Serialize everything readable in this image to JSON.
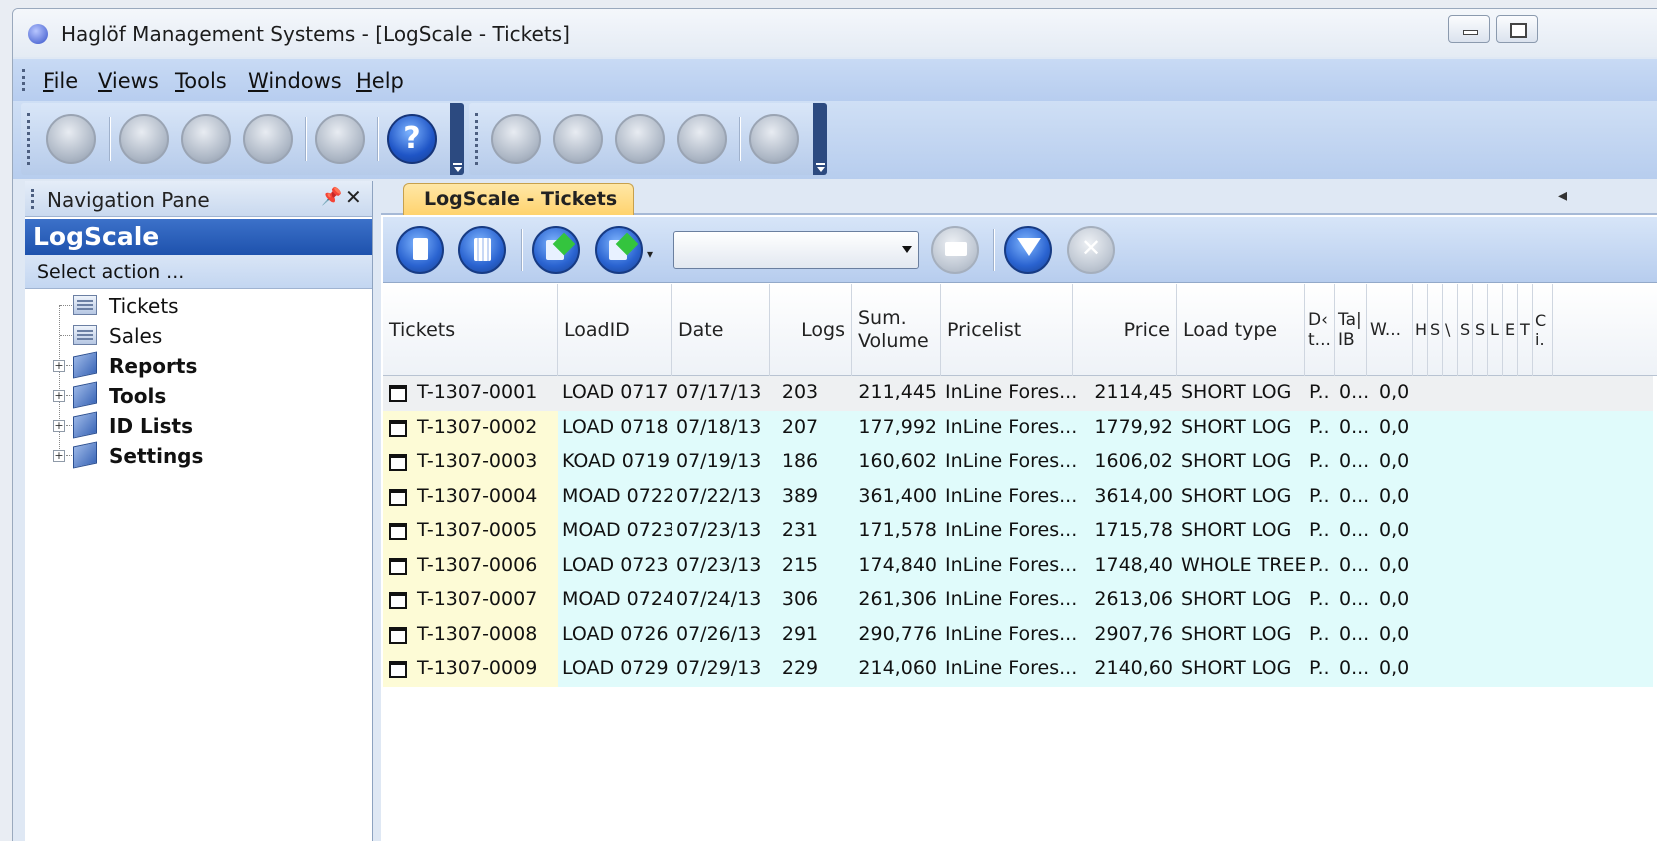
{
  "window": {
    "title": "Haglöf Management Systems - [LogScale - Tickets]"
  },
  "menu": {
    "items": [
      {
        "label": "File"
      },
      {
        "label": "Views"
      },
      {
        "label": "Tools"
      },
      {
        "label": "Windows"
      },
      {
        "label": "Help"
      }
    ]
  },
  "toolbar": {
    "main_icons": [
      "new-document-icon",
      "open-folder-icon",
      "save-icon",
      "delete-icon",
      "preview-icon",
      "help-icon"
    ],
    "help_glyph": "?",
    "nav_icons": [
      "first-record-icon",
      "previous-record-icon",
      "next-record-icon",
      "last-record-icon",
      "up-icon"
    ]
  },
  "nav_pane": {
    "title": "Navigation Pane",
    "section": "LogScale",
    "subtitle": "Select action ...",
    "items": [
      {
        "label": "Tickets",
        "bold": false,
        "expandable": false,
        "icon": "document-icon"
      },
      {
        "label": "Sales",
        "bold": false,
        "expandable": false,
        "icon": "document-icon"
      },
      {
        "label": "Reports",
        "bold": true,
        "expandable": true,
        "icon": "book-icon"
      },
      {
        "label": "Tools",
        "bold": true,
        "expandable": true,
        "icon": "book-icon"
      },
      {
        "label": "ID Lists",
        "bold": true,
        "expandable": true,
        "icon": "book-icon"
      },
      {
        "label": "Settings",
        "bold": true,
        "expandable": true,
        "icon": "book-icon"
      }
    ]
  },
  "tab": {
    "label": "LogScale - Tickets"
  },
  "grid": {
    "columns": [
      {
        "key": "ticket",
        "label": "Tickets"
      },
      {
        "key": "load_id",
        "label": "LoadID"
      },
      {
        "key": "date",
        "label": "Date"
      },
      {
        "key": "logs",
        "label": "Logs"
      },
      {
        "key": "sum_volume",
        "label": "Sum. Volume"
      },
      {
        "key": "pricelist",
        "label": "Pricelist"
      },
      {
        "key": "price",
        "label": "Price"
      },
      {
        "key": "load_type",
        "label": "Load type"
      },
      {
        "key": "d",
        "label": "D‹ t..."
      },
      {
        "key": "ta",
        "label": "Ta| IB"
      },
      {
        "key": "w",
        "label": "W..."
      },
      {
        "key": "h",
        "label": "H"
      },
      {
        "key": "s1",
        "label": "S"
      },
      {
        "key": "v",
        "label": "\\"
      },
      {
        "key": "s2",
        "label": "S"
      },
      {
        "key": "s3",
        "label": "S"
      },
      {
        "key": "l",
        "label": "L"
      },
      {
        "key": "e",
        "label": "E"
      },
      {
        "key": "t",
        "label": "T"
      },
      {
        "key": "c",
        "label": "C i."
      }
    ],
    "rows": [
      {
        "ticket": "T-1307-0001",
        "load_id": "LOAD 0717",
        "date": "07/17/13",
        "logs": "203",
        "sum_volume": "211,445",
        "pricelist": "InLine Fores...",
        "price": "2114,45",
        "load_type": "SHORT LOG",
        "d": "P..",
        "ta": "0...",
        "w": "0,0"
      },
      {
        "ticket": "T-1307-0002",
        "load_id": "LOAD 0718",
        "date": "07/18/13",
        "logs": "207",
        "sum_volume": "177,992",
        "pricelist": "InLine Fores...",
        "price": "1779,92",
        "load_type": "SHORT LOG",
        "d": "P..",
        "ta": "0...",
        "w": "0,0"
      },
      {
        "ticket": "T-1307-0003",
        "load_id": "KOAD 0719",
        "date": "07/19/13",
        "logs": "186",
        "sum_volume": "160,602",
        "pricelist": "InLine Fores...",
        "price": "1606,02",
        "load_type": "SHORT LOG",
        "d": "P..",
        "ta": "0...",
        "w": "0,0"
      },
      {
        "ticket": "T-1307-0004",
        "load_id": "MOAD 0722",
        "date": "07/22/13",
        "logs": "389",
        "sum_volume": "361,400",
        "pricelist": "InLine Fores...",
        "price": "3614,00",
        "load_type": "SHORT LOG",
        "d": "P..",
        "ta": "0...",
        "w": "0,0"
      },
      {
        "ticket": "T-1307-0005",
        "load_id": "MOAD 0723",
        "date": "07/23/13",
        "logs": "231",
        "sum_volume": "171,578",
        "pricelist": "InLine Fores...",
        "price": "1715,78",
        "load_type": "SHORT LOG",
        "d": "P..",
        "ta": "0...",
        "w": "0,0"
      },
      {
        "ticket": "T-1307-0006",
        "load_id": "LOAD 0723",
        "date": "07/23/13",
        "logs": "215",
        "sum_volume": "174,840",
        "pricelist": "InLine Fores...",
        "price": "1748,40",
        "load_type": "WHOLE TREE",
        "d": "P..",
        "ta": "0...",
        "w": "0,0"
      },
      {
        "ticket": "T-1307-0007",
        "load_id": "MOAD 0724",
        "date": "07/24/13",
        "logs": "306",
        "sum_volume": "261,306",
        "pricelist": "InLine Fores...",
        "price": "2613,06",
        "load_type": "SHORT LOG",
        "d": "P..",
        "ta": "0...",
        "w": "0,0"
      },
      {
        "ticket": "T-1307-0008",
        "load_id": "LOAD 0726",
        "date": "07/26/13",
        "logs": "291",
        "sum_volume": "290,776",
        "pricelist": "InLine Fores...",
        "price": "2907,76",
        "load_type": "SHORT LOG",
        "d": "P..",
        "ta": "0...",
        "w": "0,0"
      },
      {
        "ticket": "T-1307-0009",
        "load_id": "LOAD 0729",
        "date": "07/29/13",
        "logs": "229",
        "sum_volume": "214,060",
        "pricelist": "InLine Fores...",
        "price": "2140,60",
        "load_type": "SHORT LOG",
        "d": "P..",
        "ta": "0...",
        "w": "0,0"
      }
    ]
  },
  "colors": {
    "ticket_column_bg": "#fdfbd6",
    "data_column_bg": "#e0fbfb",
    "selected_row_bg": "#eef0f2",
    "nav_section_bg": "#2a5fb8"
  }
}
